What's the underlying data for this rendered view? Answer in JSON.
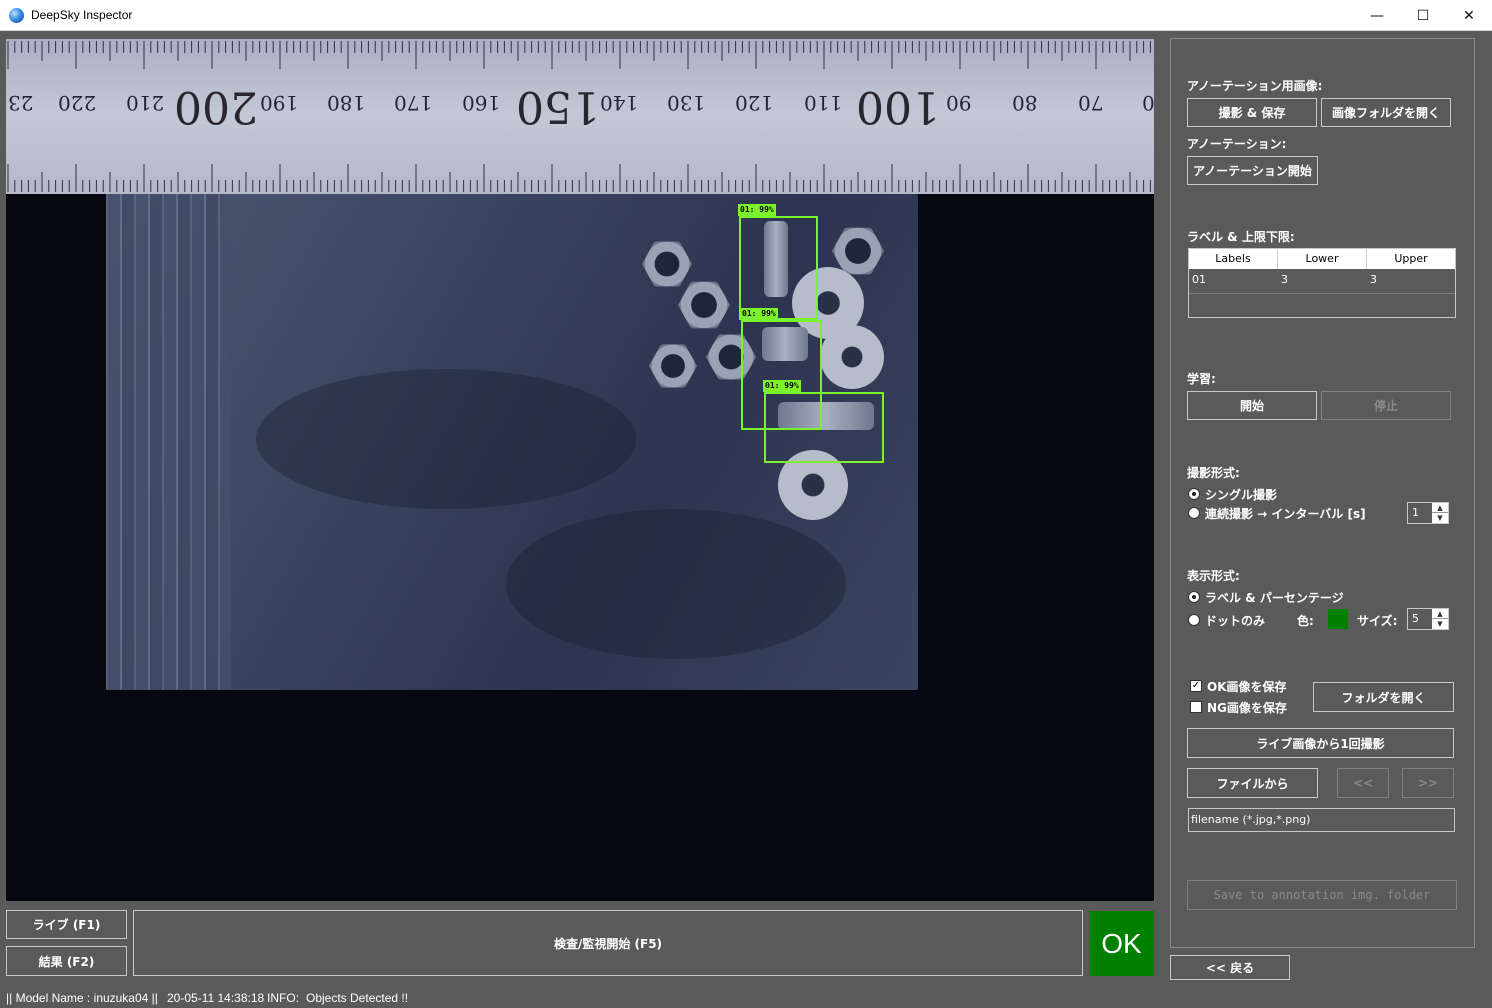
{
  "window": {
    "title": "DeepSky Inspector",
    "minimize": "—",
    "maximize": "☐",
    "close": "✕"
  },
  "camera": {
    "ruler_numbers": [
      "23",
      "220",
      "210",
      "200",
      "190",
      "180",
      "170",
      "160",
      "150",
      "140",
      "130",
      "120",
      "110",
      "100",
      "90",
      "80",
      "70",
      "0"
    ],
    "detections": [
      {
        "label": "01: 99%"
      },
      {
        "label": "01: 99%"
      },
      {
        "label": "01: 99%"
      }
    ]
  },
  "panel": {
    "annotation_image_label": "アノーテーション用画像:",
    "capture_save_button": "撮影 & 保存",
    "open_image_folder_button": "画像フォルダを開く",
    "annotation_label": "アノーテーション:",
    "start_annotation_button": "アノーテーション開始",
    "label_limits_label": "ラベル & 上限下限:",
    "table": {
      "headers": [
        "Labels",
        "Lower",
        "Upper"
      ],
      "rows": [
        [
          "01",
          "3",
          "3"
        ]
      ]
    },
    "training_label": "学習:",
    "start_button": "開始",
    "stop_button": "停止",
    "capture_mode_label": "撮影形式:",
    "single_capture": "シングル撮影",
    "continuous_capture": "連続撮影 → インターバル [s]",
    "interval_value": "1",
    "display_mode_label": "表示形式:",
    "label_percentage": "ラベル & パーセンテージ",
    "dots_only": "ドットのみ",
    "color_label": "色:",
    "dot_color": "#008000",
    "size_label": "サイズ:",
    "size_value": "5",
    "save_ok_images": "OK画像を保存",
    "save_ng_images": "NG画像を保存",
    "save_ok_checked": "✓",
    "open_folder_button": "フォルダを開く",
    "capture_once_button": "ライブ画像から1回撮影",
    "from_file_button": "ファイルから",
    "prev_button": "<<",
    "next_button": ">>",
    "filename_placeholder": "filename (*.jpg,*.png)",
    "save_annotation_button": "Save to annotation img. folder",
    "back_button": "<< 戻る"
  },
  "bottom": {
    "live_button": "ライブ (F1)",
    "results_button": "結果 (F2)",
    "inspect_button": "検査/監視開始 (F5)",
    "result_status": "OK"
  },
  "status": {
    "model": "|| Model Name : inuzuka04 ||",
    "timestamp": "20-05-11 14:38:18",
    "info_label": "INFO:",
    "info_message": "Objects Detected !!"
  }
}
